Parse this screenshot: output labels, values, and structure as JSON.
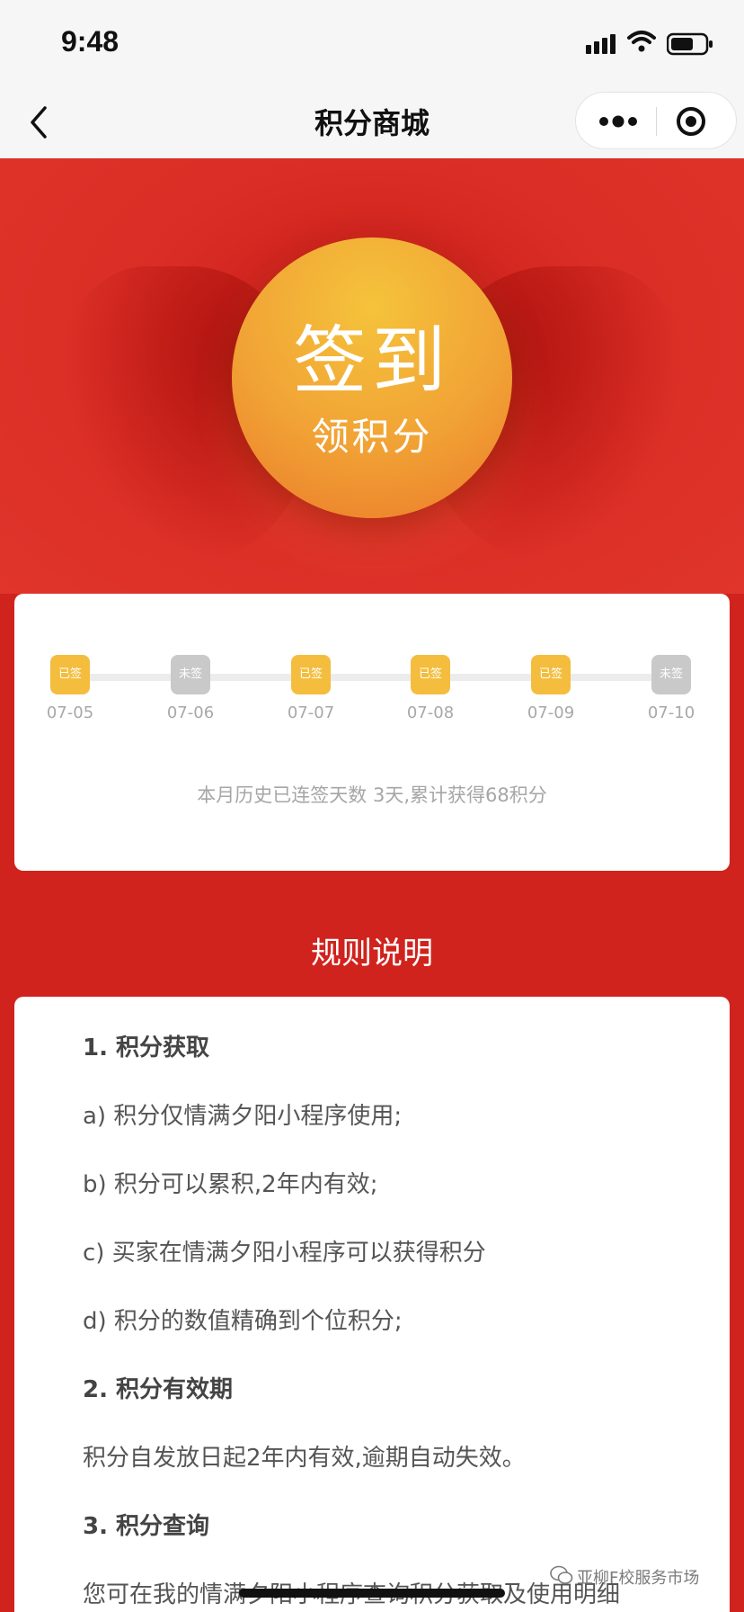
{
  "status_bar": {
    "time": "9:48"
  },
  "nav": {
    "title": "积分商城"
  },
  "hero": {
    "sign_title": "签到",
    "sign_subtitle": "领积分"
  },
  "checkin": {
    "days": [
      {
        "date": "07-05",
        "status": "已签",
        "signed": true
      },
      {
        "date": "07-06",
        "status": "未签",
        "signed": false
      },
      {
        "date": "07-07",
        "status": "已签",
        "signed": true
      },
      {
        "date": "07-08",
        "status": "已签",
        "signed": true
      },
      {
        "date": "07-09",
        "status": "已签",
        "signed": true
      },
      {
        "date": "07-10",
        "status": "未签",
        "signed": false
      }
    ],
    "summary": "本月历史已连签天数 3天,累计获得68积分"
  },
  "rules": {
    "heading": "规则说明",
    "lines": [
      {
        "text": "1. 积分获取",
        "bold": true
      },
      {
        "text": "a) 积分仅情满夕阳小程序使用;",
        "bold": false
      },
      {
        "text": "b) 积分可以累积,2年内有效;",
        "bold": false
      },
      {
        "text": "c) 买家在情满夕阳小程序可以获得积分",
        "bold": false
      },
      {
        "text": "d) 积分的数值精确到个位积分;",
        "bold": false
      },
      {
        "text": "2. 积分有效期",
        "bold": true
      },
      {
        "text": "积分自发放日起2年内有效,逾期自动失效。",
        "bold": false
      },
      {
        "text": "3. 积分查询",
        "bold": true
      },
      {
        "text": "您可在我的情满夕阳小程序查询积分获取及使用明细",
        "bold": false
      }
    ]
  },
  "watermark": {
    "text": "亚柳F校服务市场"
  },
  "colors": {
    "brand_red": "#d0231d",
    "signed": "#f4bd3d",
    "unsigned": "#c9c9c9",
    "button_gold": "#f1a235"
  },
  "icons": [
    "signal-icon",
    "wifi-icon",
    "battery-icon",
    "back-icon",
    "more-icon",
    "target-icon",
    "wechat-icon"
  ]
}
